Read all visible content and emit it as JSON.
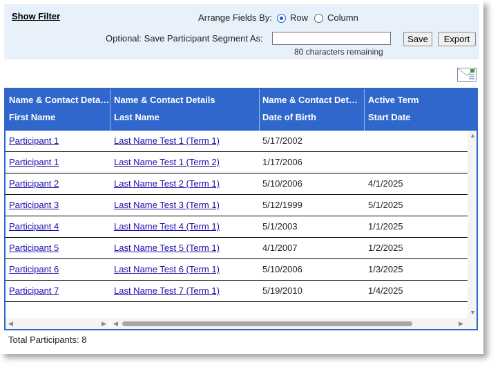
{
  "filter": {
    "show_filter": "Show Filter",
    "arrange_label": "Arrange Fields By:",
    "option_row": "Row",
    "option_column": "Column",
    "selected": "Row",
    "save_segment_label": "Optional: Save Participant Segment As:",
    "segment_value": "",
    "chars_remaining": "80 characters remaining",
    "save_button": "Save",
    "export_button": "Export"
  },
  "grid": {
    "columns": [
      {
        "group": "Name & Contact Details",
        "field": "First Name"
      },
      {
        "group": "Name & Contact Details",
        "field": "Last Name"
      },
      {
        "group": "Name & Contact Deta…",
        "field": "Date of Birth"
      },
      {
        "group": "Active Term",
        "field": "Start Date"
      }
    ],
    "rows": [
      {
        "first": "Participant 1",
        "last": "Last Name Test 1 (Term 1)",
        "dob": "5/17/2002",
        "start": ""
      },
      {
        "first": "Participant 1",
        "last": "Last Name Test 1 (Term 2)",
        "dob": "1/17/2006",
        "start": ""
      },
      {
        "first": "Participant 2",
        "last": "Last Name Test 2 (Term 1)",
        "dob": "5/10/2006",
        "start": "4/1/2025"
      },
      {
        "first": "Participant 3",
        "last": "Last Name Test 3 (Term 1)",
        "dob": "5/12/1999",
        "start": "5/1/2025"
      },
      {
        "first": "Participant 4",
        "last": "Last Name Test 4 (Term 1)",
        "dob": "5/1/2003",
        "start": "1/1/2025"
      },
      {
        "first": "Participant 5",
        "last": "Last Name Test 5 (Term 1)",
        "dob": "4/1/2007",
        "start": "1/2/2025"
      },
      {
        "first": "Participant 6",
        "last": "Last Name Test 6 (Term 1)",
        "dob": "5/10/2006",
        "start": "1/3/2025"
      },
      {
        "first": "Participant 7",
        "last": "Last Name Test 7 (Term 1)",
        "dob": "5/19/2010",
        "start": "1/4/2025"
      }
    ]
  },
  "icons": {
    "export_mail": "mail-export-icon"
  },
  "colors": {
    "header_blue": "#2f67cc",
    "filter_bg": "#e8f0fa",
    "link": "#1a0dab"
  },
  "footer": {
    "total": "Total Participants: 8"
  }
}
